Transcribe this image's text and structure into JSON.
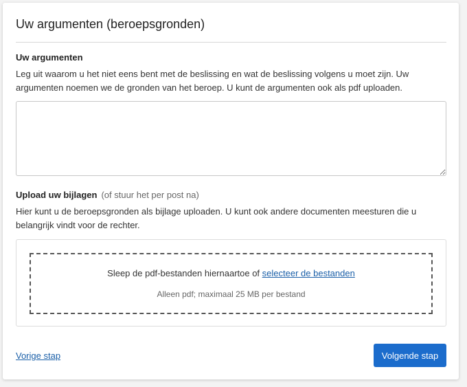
{
  "card": {
    "title": "Uw argumenten (beroepsgronden)"
  },
  "arguments": {
    "heading": "Uw argumenten",
    "description": "Leg uit waarom u het niet eens bent met de beslissing en wat de beslissing volgens u moet zijn. Uw argumenten noemen we de gronden van het beroep. U kunt de argumenten ook als pdf uploaden.",
    "textarea_value": "",
    "textarea_placeholder": ""
  },
  "upload": {
    "heading": "Upload uw bijlagen",
    "heading_note": "(of stuur het per post na)",
    "description": "Hier kunt u de beroepsgronden als bijlage uploaden. U kunt ook andere documenten meesturen die u belangrijk vindt voor de rechter.",
    "drop_text": "Sleep de pdf-bestanden hiernaartoe of ",
    "select_link": "selecteer de bestanden",
    "hint": "Alleen pdf; maximaal 25 MB per bestand"
  },
  "navigation": {
    "back_label": "Vorige stap",
    "next_label": "Volgende stap"
  },
  "colors": {
    "primary": "#1b6ccc",
    "link": "#1a5fa8",
    "background": "#f3f3f3"
  }
}
